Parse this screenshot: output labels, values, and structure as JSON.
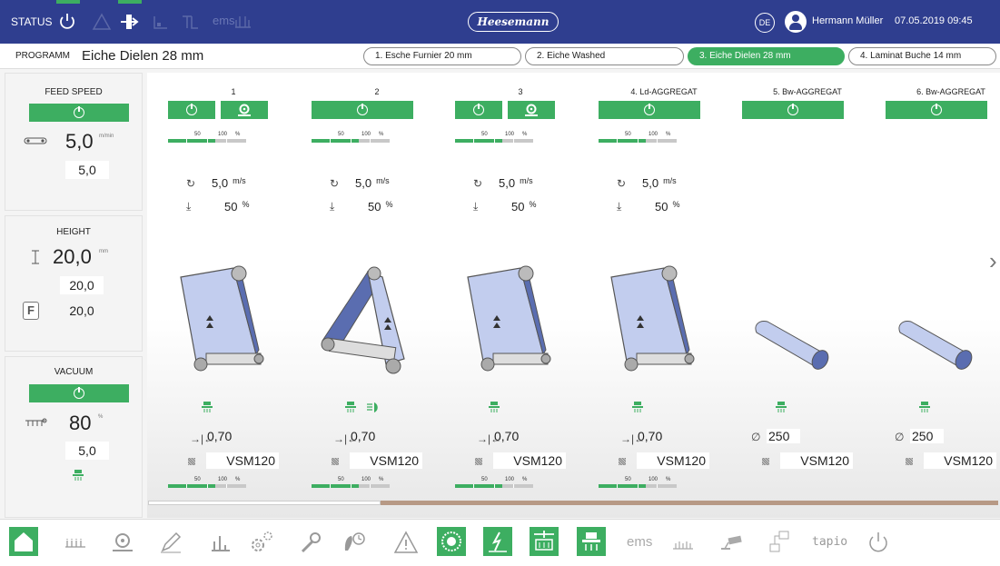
{
  "topbar": {
    "status_label": "STATUS",
    "ems_label": "ems",
    "brand": "Heesemann",
    "language": "DE",
    "user_name": "Hermann Müller",
    "datetime": "07.05.2019 09:45"
  },
  "program": {
    "label": "PROGRAMM",
    "name": "Eiche Dielen 28 mm",
    "tabs": [
      {
        "label": "1. Esche Furnier 20 mm",
        "active": false
      },
      {
        "label": "2. Eiche Washed",
        "active": false
      },
      {
        "label": "3. Eiche Dielen 28 mm",
        "active": true
      },
      {
        "label": "4. Laminat Buche 14 mm",
        "active": false
      }
    ]
  },
  "feed": {
    "title": "FEED SPEED",
    "value": "5,0",
    "unit": "m/min",
    "setpoint": "5,0"
  },
  "height": {
    "title": "HEIGHT",
    "value": "20,0",
    "unit": "mm",
    "setpoint": "20,0",
    "f_label": "F",
    "f_value": "20,0"
  },
  "vacuum": {
    "title": "VACUUM",
    "value": "80",
    "unit": "%",
    "setpoint": "5,0"
  },
  "bar_labels": {
    "mid": "50",
    "max": "100",
    "pct": "%"
  },
  "columns": [
    {
      "title": "1",
      "speed": "5,0",
      "speed_unit": "m/s",
      "pressure": "50",
      "pressure_unit": "%",
      "gap": "0,70",
      "belt": "VSM120",
      "top_level": 0.6,
      "bottom_level": 0.6
    },
    {
      "title": "2",
      "speed": "5,0",
      "speed_unit": "m/s",
      "pressure": "50",
      "pressure_unit": "%",
      "gap": "0,70",
      "belt": "VSM120",
      "top_level": 0.6,
      "bottom_level": 0.6
    },
    {
      "title": "3",
      "speed": "5,0",
      "speed_unit": "m/s",
      "pressure": "50",
      "pressure_unit": "%",
      "gap": "0,70",
      "belt": "VSM120",
      "top_level": 0.6,
      "bottom_level": 0.6
    },
    {
      "title": "4. Ld-AGGREGAT",
      "speed": "5,0",
      "speed_unit": "m/s",
      "pressure": "50",
      "pressure_unit": "%",
      "gap": "0,70",
      "belt": "VSM120",
      "top_level": 0.6,
      "bottom_level": 0.6
    },
    {
      "title": "5. Bw-AGGREGAT",
      "diameter": "250",
      "belt": "VSM120"
    },
    {
      "title": "6. Bw-AGGREGAT",
      "diameter": "250",
      "belt": "VSM120"
    }
  ],
  "bottom": {
    "ems": "ems",
    "tapio": "tapio"
  },
  "colors": {
    "brand_blue": "#2f3e8f",
    "green": "#3dae61",
    "belt_blue": "#c2cdee",
    "belt_dark": "#5a6db0"
  }
}
